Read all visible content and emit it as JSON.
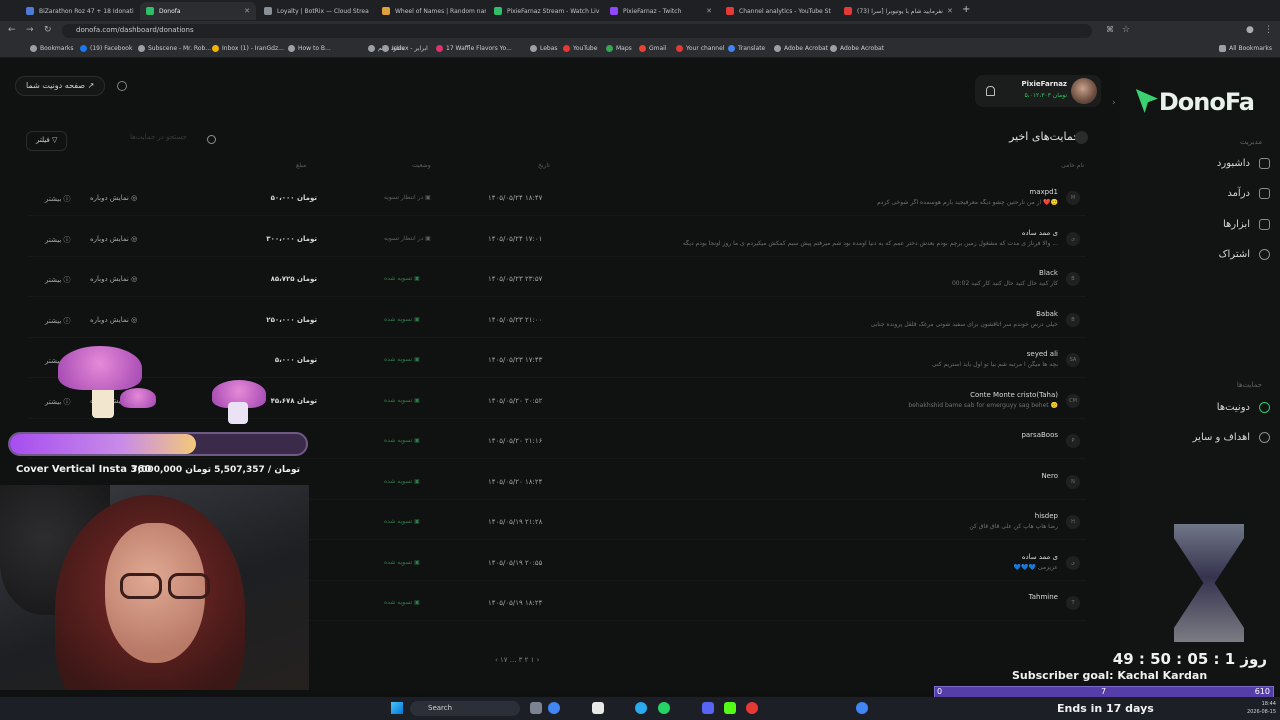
{
  "browser": {
    "tabs": [
      {
        "title": "BiZarathon Roz 47 + 18 Idonati",
        "color": "#4f7ad8",
        "active": false
      },
      {
        "title": "Donofa",
        "color": "#2fbf69",
        "active": true
      },
      {
        "title": "Loyalty | BotRix — Cloud Strea",
        "color": "#8a8f95",
        "active": false
      },
      {
        "title": "Wheel of Names | Random nam",
        "color": "#e0a23a",
        "active": false
      },
      {
        "title": "PixieFarnaz Stream - Watch Liv",
        "color": "#2fbf69",
        "active": false
      },
      {
        "title": "PixieFarnaz - Twitch",
        "color": "#9147ff",
        "active": false
      },
      {
        "title": "Channel analytics - YouTube St",
        "color": "#e53935",
        "active": false
      },
      {
        "title": "(73) نفرمایید شام با یوتیوبرا [سرا",
        "color": "#e53935",
        "active": false
      }
    ],
    "url": "donofa.com/dashboard/donations",
    "bookmarks": [
      {
        "label": "Bookmarks",
        "color": "#9aa0a6"
      },
      {
        "label": "(19) Facebook",
        "color": "#1877f2"
      },
      {
        "label": "Subscene - Mr. Rob...",
        "color": "#9aa0a6"
      },
      {
        "label": "Inbox (1) - IranGdz...",
        "color": "#f4b400"
      },
      {
        "label": "How to B...",
        "color": "#9aa0a6"
      },
      {
        "label": "دانلود فیلم",
        "color": "#9aa0a6"
      },
      {
        "label": "Index - ابرایر",
        "color": "#9aa0a6"
      },
      {
        "label": "17 Waffle Flavors Yo...",
        "color": "#e1306c"
      },
      {
        "label": "Lebas",
        "color": "#9aa0a6"
      },
      {
        "label": "YouTube",
        "color": "#e53935"
      },
      {
        "label": "Maps",
        "color": "#34a853"
      },
      {
        "label": "Gmail",
        "color": "#ea4335"
      },
      {
        "label": "Your channel",
        "color": "#e53935"
      },
      {
        "label": "Translate",
        "color": "#4285f4"
      },
      {
        "label": "Adobe Acrobat",
        "color": "#9aa0a6"
      },
      {
        "label": "Adobe Acrobat",
        "color": "#9aa0a6"
      }
    ],
    "all_bookmarks": "All Bookmarks"
  },
  "header": {
    "donate_page_button": "صفحه دونیت شما",
    "user_name": "PixieFarnaz",
    "user_balance": "۵،۰۱۲،۳۰۳ تومان"
  },
  "sidebar": {
    "logo_text": "DonoFa",
    "section_manage": "مدیریت",
    "items_manage": [
      "داشبورد",
      "درآمد",
      "ابزارها",
      "اشتراک"
    ],
    "section_support": "حمایت‌ها",
    "items_support": [
      "دونیت‌ها",
      "اهداف و سایر"
    ]
  },
  "main": {
    "title": "حمایت‌های اخیر",
    "filter_label": "فیلتر",
    "search_placeholder": "جستجو در حمایت‌ها",
    "columns": {
      "name": "نام حامی",
      "date": "تاریخ",
      "status": "وضعیت",
      "amount": "مبلغ"
    },
    "replay_label": "نمایش دوباره",
    "more_label": "بیشتر",
    "rows": [
      {
        "initial": "M",
        "name": "maxpd1",
        "message": "از من نارحتین چشو دیگه معرفیجید بازم هوسمده اگر شوخی کردم ❤️🙂",
        "date": "۱۴۰۵/۰۵/۲۴ ۱۸:۴۷",
        "status": "در انتظار تسویه",
        "pending": true,
        "amount": "۵۰،۰۰۰ تومان"
      },
      {
        "initial": "ی",
        "name": "ی ممد ساده",
        "message": "والا فرناز ی مدت که مشغول زمین برچم بودم بعدش دختر عمم که به دنیا اومده بود شم میرفتم پیش سبم کمکش میکیردم ی ما روز اونجا بودم دیگه ...",
        "date": "۱۴۰۵/۰۵/۲۴ ۱۷:۰۱",
        "status": "در انتظار تسویه",
        "pending": true,
        "amount": "۳۰۰،۰۰۰ تومان"
      },
      {
        "initial": "B",
        "name": "Black",
        "message": "00:02 کار کنید حال کنید حال کنید کار کنید",
        "date": "۱۴۰۵/۰۵/۲۳ ۲۳:۵۷",
        "status": "تسویه شده",
        "pending": false,
        "amount": "۸۵،۷۲۵ تومان"
      },
      {
        "initial": "B",
        "name": "Babak",
        "message": "خیلی درس خوندم سر اتاقشون برای سفید شوتی مرغک قلقل پرونده جنایی",
        "date": "۱۴۰۵/۰۵/۲۳ ۲۱:۰۰",
        "status": "تسویه شده",
        "pending": false,
        "amount": "۲۵۰،۰۰۰ تومان"
      },
      {
        "initial": "SA",
        "name": "seyed ali",
        "message": "بچه ها میگن ا مرتبه شم بیا تو اول باید استریم کنی",
        "date": "۱۴۰۵/۰۵/۲۳ ۱۷:۴۳",
        "status": "تسویه شده",
        "pending": false,
        "amount": "۵،۰۰۰ تومان"
      },
      {
        "initial": "CM",
        "name": "Conte Monte cristo(Taha)",
        "message": "behakhshid bame sab for emerguyy sag behet 🙁",
        "date": "۱۴۰۵/۰۵/۲۰ ۲۰:۵۲",
        "status": "تسویه شده",
        "pending": false,
        "amount": "۴۵،۶۷۸ تومان"
      },
      {
        "initial": "P",
        "name": "parsaBoos",
        "message": "",
        "date": "۱۴۰۵/۰۵/۲۰ ۲۱:۱۶",
        "status": "تسویه شده",
        "pending": false,
        "amount": ""
      },
      {
        "initial": "N",
        "name": "Nero",
        "message": "",
        "date": "۱۴۰۵/۰۵/۲۰ ۱۸:۲۴",
        "status": "تسویه شده",
        "pending": false,
        "amount": ""
      },
      {
        "initial": "H",
        "name": "hisdep",
        "message": "رضا هاپ هاپ کن علی قاق قاق کن",
        "date": "۱۴۰۵/۰۵/۱۹ ۲۱:۲۸",
        "status": "تسویه شده",
        "pending": false,
        "amount": ""
      },
      {
        "initial": "ی",
        "name": "ی ممد ساده",
        "message": "💙💙💙 عزیزمی",
        "date": "۱۴۰۵/۰۵/۱۹ ۲۰:۵۵",
        "status": "تسویه شده",
        "pending": false,
        "amount": ""
      },
      {
        "initial": "T",
        "name": "Tahmine",
        "message": "",
        "date": "۱۴۰۵/۰۵/۱۹ ۱۸:۲۴",
        "status": "تسویه شده",
        "pending": false,
        "amount": ""
      }
    ],
    "pagination": "‹   ۱۷   ...   ۳   ۲   ۱   ›"
  },
  "overlays": {
    "goal_name": "Cover Vertical Insta 360",
    "goal_amounts": "7,000,000 تومان / 5,507,357 تومان",
    "goal_progress": 0.787,
    "timer": "49 : 50 : 05 : 1 روز",
    "subscriber_goal": "Subscriber goal: Kachal Kardan",
    "sub_start": "0",
    "sub_current": "7",
    "sub_target": "610",
    "ends": "Ends in 17 days"
  },
  "taskbar": {
    "search_label": "Search",
    "lang": "ENG\nUS",
    "time": "18:44",
    "date": "2026-08-15"
  }
}
